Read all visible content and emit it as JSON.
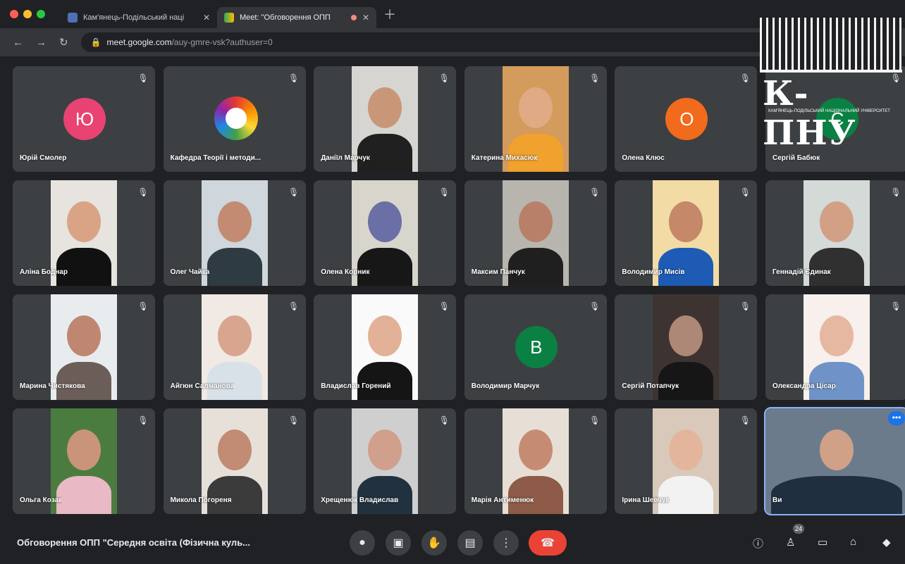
{
  "browser": {
    "tabs": [
      {
        "title": "Кам'янець-Подільський наці",
        "active": false
      },
      {
        "title": "Meet: \"Обговорення ОПП",
        "active": true
      }
    ],
    "url_domain": "meet.google.com",
    "url_path": "/auy-gmre-vsk?authuser=0"
  },
  "watermark": {
    "text": "К-ПНУ",
    "subtitle": "КАМ'ЯНЕЦЬ-ПОДІЛЬСЬКИЙ НАЦІОНАЛЬНИЙ УНІВЕРСИТЕТ"
  },
  "participants": [
    {
      "name": "Юрій Смолер",
      "avatar": "Ю",
      "avatar_color": "#e84372"
    },
    {
      "name": "Кафедра Теорії і методи...",
      "avatar_logo": true
    },
    {
      "name": "Даніїл Марчук",
      "video": true,
      "bg": "#d7d5d2",
      "skin": "#c99778",
      "body": "#202020"
    },
    {
      "name": "Катерина Михасюк",
      "video": true,
      "bg": "#d39b5c",
      "skin": "#e0aa84",
      "body": "#f0a12e"
    },
    {
      "name": "Олена Клюс",
      "avatar": "О",
      "avatar_color": "#f26a1b"
    },
    {
      "name": "Сергій Бабюк",
      "avatar": "С",
      "avatar_color": "#0b8043"
    },
    {
      "name": "Аліна Боднар",
      "video": true,
      "bg": "#e7e3df",
      "skin": "#d9a486",
      "body": "#111111"
    },
    {
      "name": "Олег Чайка",
      "video": true,
      "bg": "#cfd6dc",
      "skin": "#c38c72",
      "body": "#2f3b42"
    },
    {
      "name": "Олена Корник",
      "video": true,
      "bg": "#d8d5cd",
      "skin": "#6a70a5",
      "body": "#171717"
    },
    {
      "name": "Максим Панчук",
      "video": true,
      "bg": "#b8b5ae",
      "skin": "#b88069",
      "body": "#1f1f1f"
    },
    {
      "name": "Володимир Мисів",
      "video": true,
      "bg": "#f2dba5",
      "skin": "#c58869",
      "body": "#1e5bb5"
    },
    {
      "name": "Геннадій Єдинак",
      "video": true,
      "bg": "#d4dad8",
      "skin": "#d2a185",
      "body": "#303030"
    },
    {
      "name": "Марина Чистякова",
      "video": true,
      "bg": "#e9ecef",
      "skin": "#bf8771",
      "body": "#6b5e59"
    },
    {
      "name": "Айгюн Салманова",
      "video": true,
      "bg": "#f1e9e4",
      "skin": "#d8a58f",
      "body": "#d8e1e8"
    },
    {
      "name": "Владислав Горений",
      "video": true,
      "bg": "#fafafa",
      "skin": "#e2b198",
      "body": "#151515"
    },
    {
      "name": "Володимир Марчук",
      "avatar": "В",
      "avatar_color": "#0b8043"
    },
    {
      "name": "Сергій Потапчук",
      "video": true,
      "bg": "#3d3432",
      "skin": "#ad8876",
      "body": "#161616"
    },
    {
      "name": "Олександра Цісар",
      "video": true,
      "bg": "#f7f0ec",
      "skin": "#e6b7a1",
      "body": "#6f93c7"
    },
    {
      "name": "Ольга Козак",
      "video": true,
      "bg": "#4b7c3f",
      "skin": "#c99479",
      "body": "#e9b9c5"
    },
    {
      "name": "Микола Погореня",
      "video": true,
      "bg": "#e7e0d8",
      "skin": "#c28b73",
      "body": "#3b3b3b"
    },
    {
      "name": "Хрещенюк Владислав",
      "video": true,
      "bg": "#cfcfcf",
      "skin": "#d0a08d",
      "body": "#223140"
    },
    {
      "name": "Марія Антименюк",
      "video": true,
      "bg": "#e7dfd6",
      "skin": "#c68c73",
      "body": "#8d5b47"
    },
    {
      "name": "Ірина Шевчук",
      "video": true,
      "bg": "#d8c9bb",
      "skin": "#e3b59d",
      "body": "#f2f2f2"
    },
    {
      "name": "Ви",
      "video": true,
      "bg": "#6b7b8c",
      "skin": "#d0a087",
      "body": "#1f2f3f",
      "selected": true
    }
  ],
  "bottom_bar": {
    "meeting_title": "Обговорення ОПП \"Середня освіта (Фізична куль...",
    "participants_count": "24"
  }
}
